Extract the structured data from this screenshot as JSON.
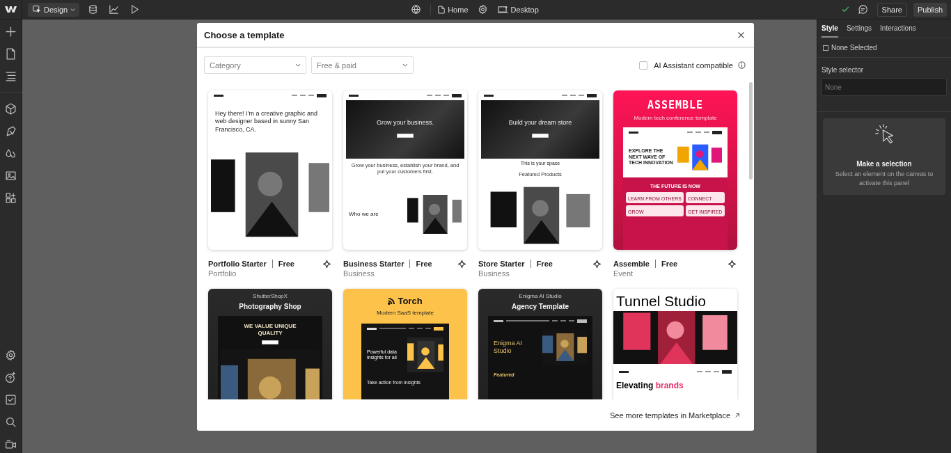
{
  "topbar": {
    "mode_button": "Design",
    "page": "Home",
    "breakpoint": "Desktop",
    "share": "Share",
    "publish": "Publish"
  },
  "dialog": {
    "title": "Choose a template",
    "filters": [
      {
        "label": "Category"
      },
      {
        "label": "Free & paid"
      }
    ],
    "ai_filter": {
      "label": "AI Assistant compatible",
      "checked": false
    },
    "templates": [
      {
        "name": "Portfolio Starter",
        "price": "Free",
        "category": "Portfolio",
        "preview": {
          "kind": "light",
          "blocks": [
            {
              "kind": "nav"
            },
            {
              "kind": "heading",
              "text": "Hey there! I’m a creative graphic and web designer based in sunny San Francisco, CA."
            },
            {
              "kind": "picture"
            }
          ]
        }
      },
      {
        "name": "Business Starter",
        "price": "Free",
        "category": "Business",
        "preview": {
          "kind": "light",
          "blocks": [
            {
              "kind": "nav"
            },
            {
              "kind": "hero",
              "text": "Grow your business."
            },
            {
              "kind": "caption",
              "text": "Grow your business, establish your brand, and put your customers first."
            },
            {
              "kind": "split",
              "text": "Who we are"
            }
          ]
        }
      },
      {
        "name": "Store Starter",
        "price": "Free",
        "category": "Business",
        "preview": {
          "kind": "light",
          "blocks": [
            {
              "kind": "nav"
            },
            {
              "kind": "hero",
              "text": "Build your dream store"
            },
            {
              "kind": "subtitle",
              "text": "This is your space"
            },
            {
              "kind": "caption",
              "text": "Featured Products"
            },
            {
              "kind": "picture"
            }
          ]
        }
      },
      {
        "name": "Assemble",
        "price": "Free",
        "category": "Event",
        "preview": {
          "kind": "pink",
          "blocks": [
            {
              "kind": "title",
              "text": "ASSEMBLE"
            },
            {
              "kind": "subtitle",
              "text": "Modern tech conference template"
            },
            {
              "kind": "frame",
              "blocks": [
                {
                  "kind": "nav"
                },
                {
                  "kind": "split",
                  "text": "EXPLORE THE NEXT WAVE OF TECH INNOVATION"
                },
                {
                  "kind": "caption",
                  "text": "THE FUTURE IS NOW"
                },
                {
                  "kind": "cards",
                  "items": [
                    "LEARN FROM OTHERS",
                    "CONNECT",
                    "GROW",
                    "GET INSPIRED"
                  ]
                }
              ]
            }
          ]
        }
      },
      {
        "preview": {
          "kind": "dark",
          "blocks": [
            {
              "kind": "subtitle",
              "text": "ShutterShopX"
            },
            {
              "kind": "title",
              "text": "Photography Shop"
            },
            {
              "kind": "frame",
              "blocks": [
                {
                  "kind": "heading",
                  "text": "WE VALUE UNIQUE QUALITY"
                },
                {
                  "kind": "button"
                },
                {
                  "kind": "picture"
                }
              ]
            }
          ]
        }
      },
      {
        "preview": {
          "kind": "yellow",
          "blocks": [
            {
              "kind": "brand",
              "text": "Torch"
            },
            {
              "kind": "subtitle",
              "text": "Modern SaaS template"
            },
            {
              "kind": "frame",
              "blocks": [
                {
                  "kind": "nav"
                },
                {
                  "kind": "split",
                  "text": "Powerful data insights for all"
                },
                {
                  "kind": "caption",
                  "text": "Take action from insights"
                }
              ]
            }
          ]
        }
      },
      {
        "preview": {
          "kind": "dark",
          "blocks": [
            {
              "kind": "subtitle",
              "text": "Enigma AI Studio"
            },
            {
              "kind": "title",
              "text": "Agency Template"
            },
            {
              "kind": "frame",
              "blocks": [
                {
                  "kind": "nav"
                },
                {
                  "kind": "split",
                  "text": "Enigma AI Studio"
                },
                {
                  "kind": "caption",
                  "text": "Featured"
                }
              ]
            }
          ]
        }
      },
      {
        "preview": {
          "kind": "tunnel",
          "blocks": [
            {
              "kind": "title",
              "text": "Tunnel Studio"
            },
            {
              "kind": "picture"
            },
            {
              "kind": "frame",
              "blocks": [
                {
                  "kind": "nav"
                },
                {
                  "kind": "heading",
                  "text": "Elevating",
                  "accent": "brands"
                }
              ]
            }
          ]
        }
      }
    ],
    "footer_link": "See more templates in Marketplace"
  },
  "panel": {
    "tabs": [
      {
        "label": "Style",
        "selected": true
      },
      {
        "label": "Settings",
        "selected": false
      },
      {
        "label": "Interactions",
        "selected": false
      }
    ],
    "selection": {
      "label": "None Selected",
      "checked": false
    },
    "selector_label": "Style selector",
    "selector_placeholder": "None",
    "empty_state": {
      "title": "Make a selection",
      "text": "Select an element on the canvas to activate this panel"
    }
  }
}
